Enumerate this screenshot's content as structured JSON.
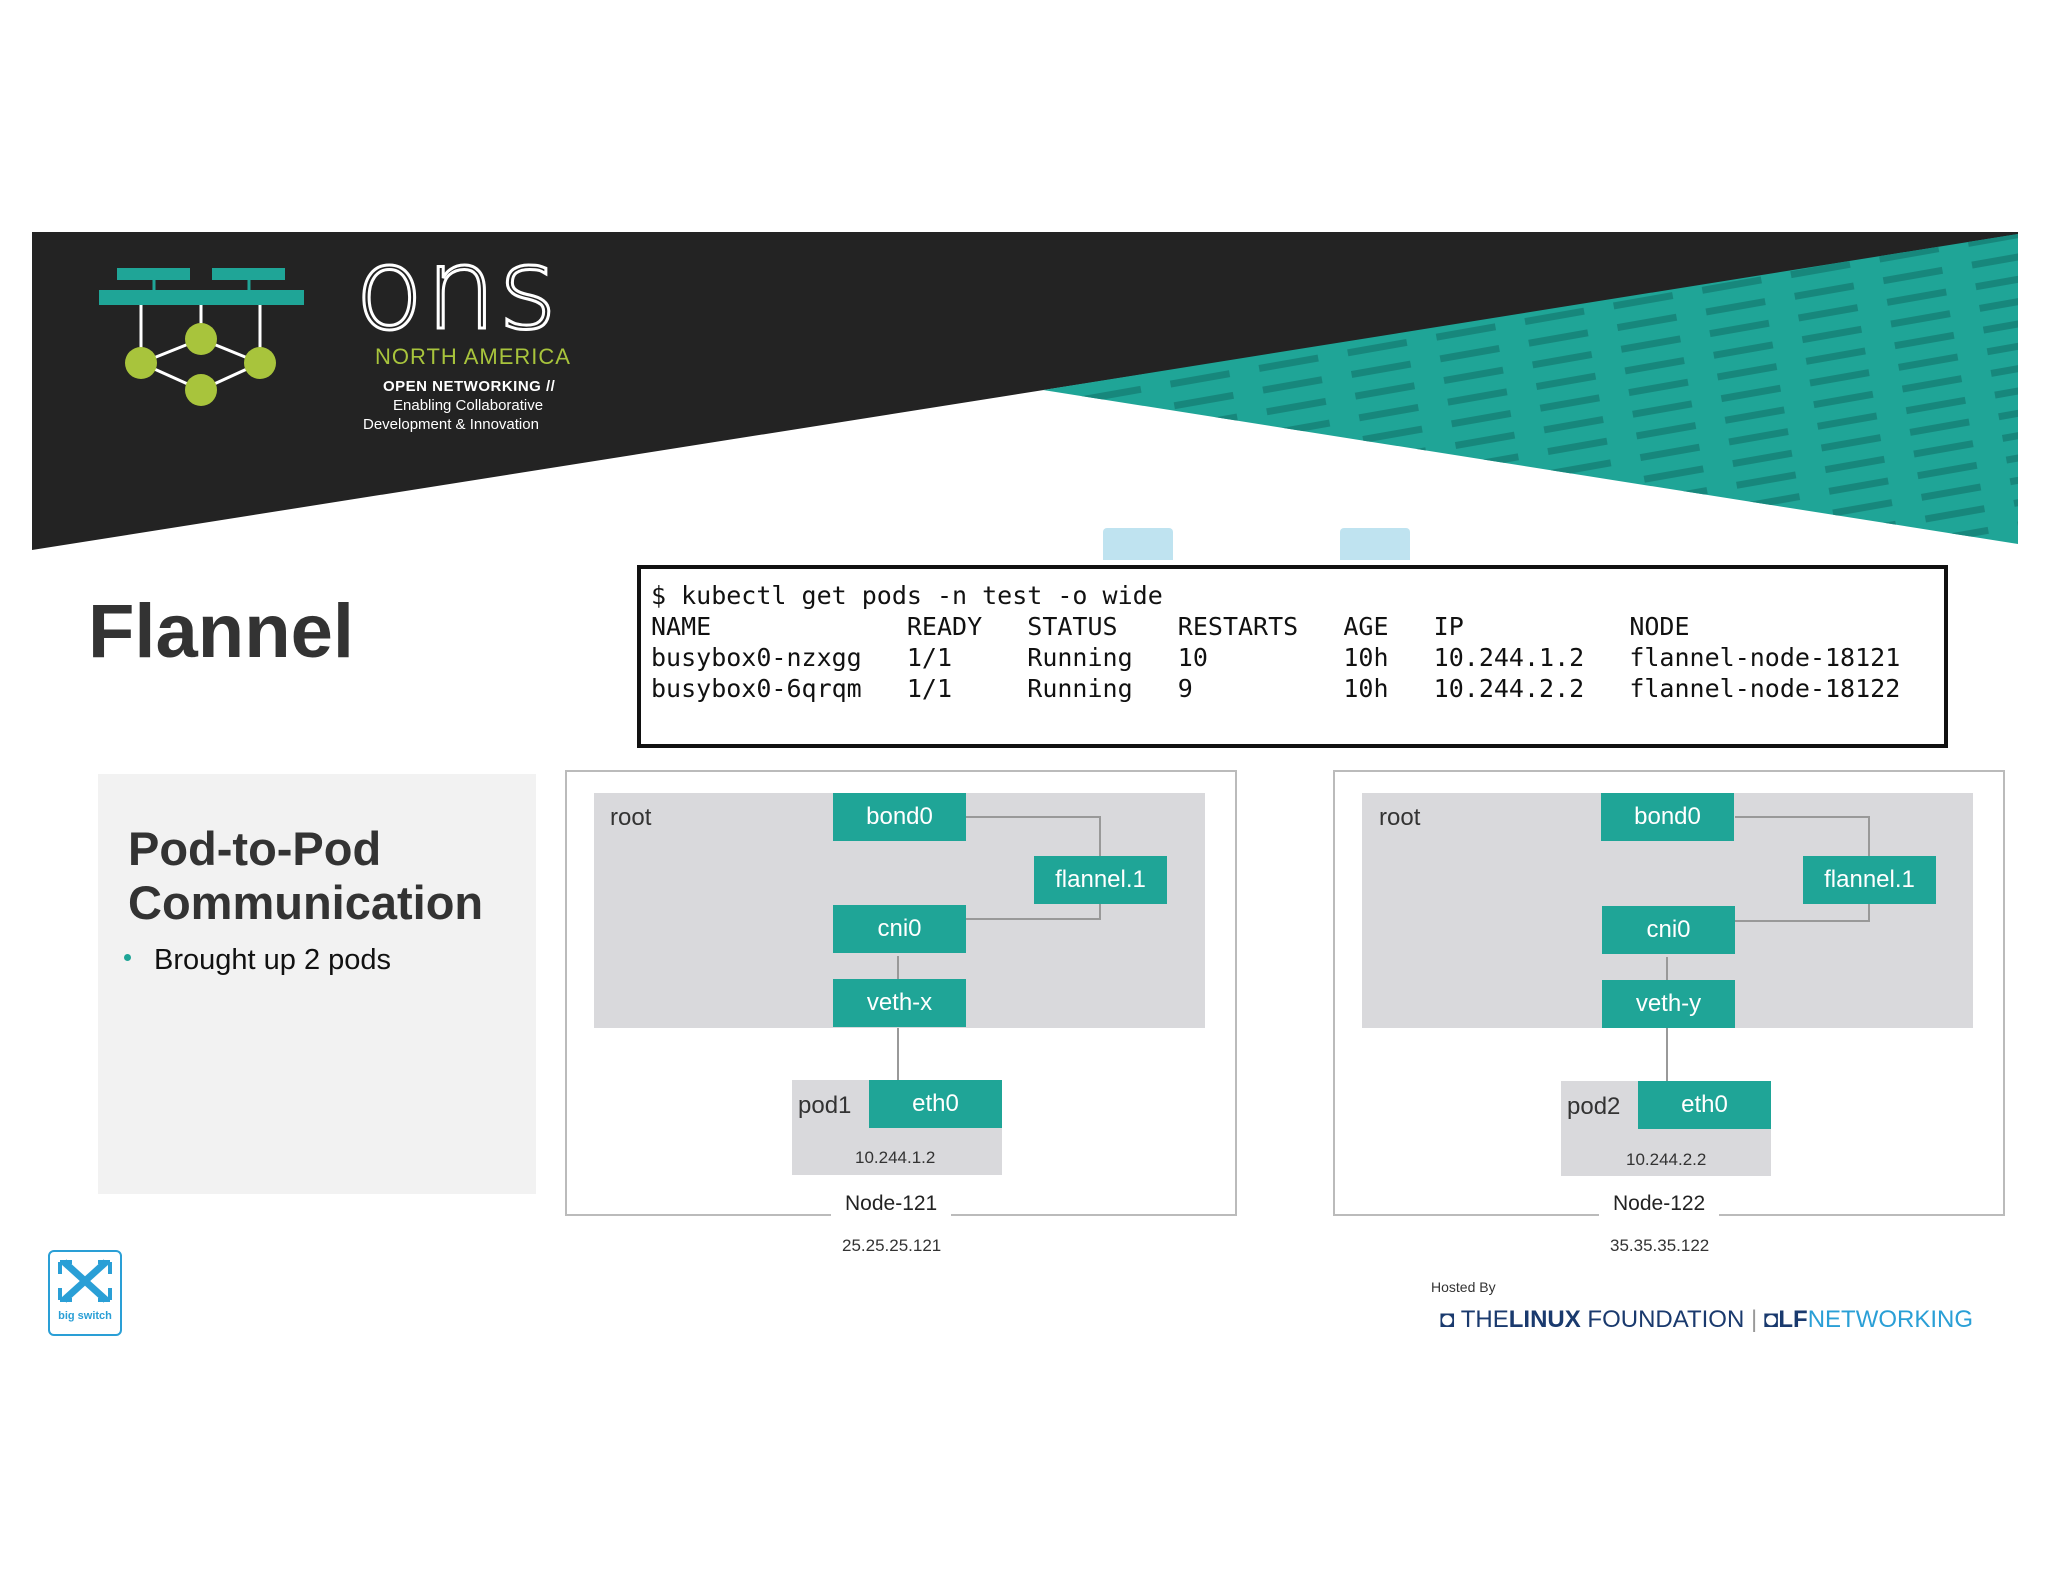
{
  "banner": {
    "brand": "ons",
    "region": "NORTH AMERICA",
    "tagline_1": "OPEN NETWORKING //",
    "tagline_2": "Enabling Collaborative",
    "tagline_3": "Development & Innovation",
    "colors": {
      "dark": "#222222",
      "teal": "#1fa597",
      "green": "#a8c43c"
    }
  },
  "slide": {
    "title": "Flannel",
    "section_title_1": "Pod-to-Pod",
    "section_title_2": "Communication",
    "bullet": "Brought up 2 pods"
  },
  "terminal": {
    "lines": [
      "$ kubectl get pods -n test -o wide",
      "NAME             READY   STATUS    RESTARTS   AGE   IP           NODE",
      "busybox0-nzxgg   1/1     Running   10         10h   10.244.1.2   flannel-node-18121",
      "busybox0-6qrqm   1/1     Running   9          10h   10.244.2.2   flannel-node-18122"
    ]
  },
  "nodes": [
    {
      "root": "root",
      "bond": "bond0",
      "flannel": "flannel.1",
      "cni": "cni0",
      "veth": "veth-x",
      "pod": "pod1",
      "eth": "eth0",
      "pod_ip": "10.244.1.2",
      "name": "Node-121",
      "ip": "25.25.25.121"
    },
    {
      "root": "root",
      "bond": "bond0",
      "flannel": "flannel.1",
      "cni": "cni0",
      "veth": "veth-y",
      "pod": "pod2",
      "eth": "eth0",
      "pod_ip": "10.244.2.2",
      "name": "Node-122",
      "ip": "35.35.35.122"
    }
  ],
  "footer": {
    "sponsor": "big switch",
    "hosted_by": "Hosted By",
    "lf_part1": "THE",
    "lf_part2": "LINUX",
    "lf_part3": "FOUNDATION",
    "lfn_part1": "LF",
    "lfn_part2": "NETWORKING"
  }
}
